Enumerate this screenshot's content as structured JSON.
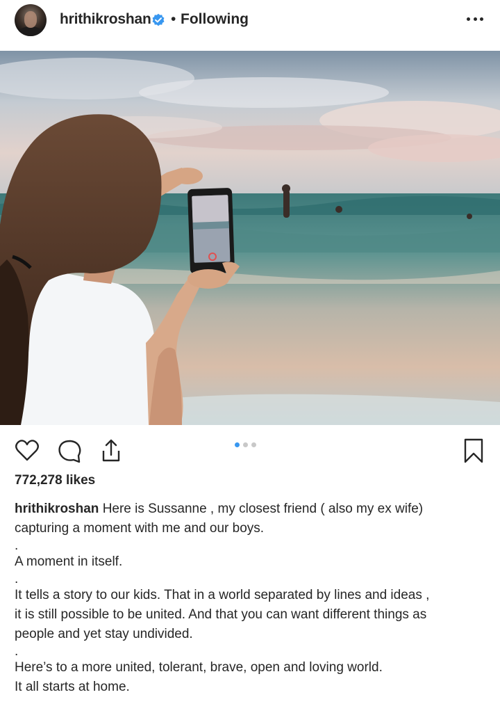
{
  "post": {
    "username": "hrithikroshan",
    "separator": "•",
    "follow_status": "Following",
    "verified_icon": "verified-badge-icon",
    "more_icon": "more-options-icon"
  },
  "photo": {
    "description_icon": "beach-photo"
  },
  "actions": {
    "like_icon": "heart-icon",
    "comment_icon": "comment-icon",
    "share_icon": "share-icon",
    "save_icon": "bookmark-icon",
    "carousel_total": 3,
    "carousel_active": 1
  },
  "likes": "772,278 likes",
  "caption": {
    "username": "hrithikroshan",
    "line1": "Here is Sussanne , my closest friend ( also my ex wife)",
    "line2": "capturing a moment with me and our boys.",
    "dot1": ".",
    "line3": "A moment in itself.",
    "dot2": ".",
    "line4": "It tells a story to our kids. That in a world separated by lines and ideas ,",
    "line5": "it is still possible to be united. And that you can want different things as",
    "line6": "people and yet stay undivided.",
    "dot3": ".",
    "line7": "Here’s to a more united, tolerant, brave, open and loving world.",
    "line8": "It all starts at home."
  },
  "colors": {
    "accent": "#3897f0",
    "text": "#262626"
  }
}
